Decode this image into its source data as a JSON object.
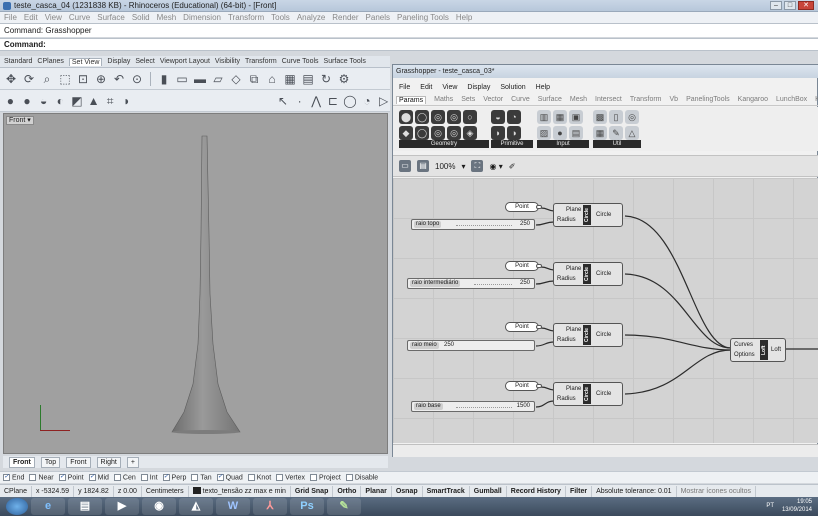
{
  "rhino": {
    "title": "teste_casca_04 (1231838 KB) - Rhinoceros (Educational) (64-bit) - [Front]",
    "menu": [
      "File",
      "Edit",
      "View",
      "Curve",
      "Surface",
      "Solid",
      "Mesh",
      "Dimension",
      "Transform",
      "Tools",
      "Analyze",
      "Render",
      "Panels",
      "Paneling Tools",
      "Help"
    ],
    "command_history": "Command: Grasshopper",
    "command_prompt": "Command:",
    "toolbar_tabs": [
      "Standard",
      "CPlanes",
      "Set View",
      "Display",
      "Select",
      "Viewport Layout",
      "Visibility",
      "Transform",
      "Curve Tools",
      "Surface Tools"
    ],
    "active_tab_index": 2,
    "viewport_label": "Front",
    "viewport_tabs": [
      "Front",
      "Top",
      "Front",
      "Right"
    ],
    "viewport_add": "+",
    "osnaps": [
      {
        "label": "End",
        "checked": true
      },
      {
        "label": "Near",
        "checked": false
      },
      {
        "label": "Point",
        "checked": true
      },
      {
        "label": "Mid",
        "checked": true
      },
      {
        "label": "Cen",
        "checked": false
      },
      {
        "label": "Int",
        "checked": false
      },
      {
        "label": "Perp",
        "checked": true
      },
      {
        "label": "Tan",
        "checked": false
      },
      {
        "label": "Quad",
        "checked": true
      },
      {
        "label": "Knot",
        "checked": false
      },
      {
        "label": "Vertex",
        "checked": false
      },
      {
        "label": "Project",
        "checked": false
      },
      {
        "label": "Disable",
        "checked": false
      }
    ],
    "status": {
      "cplane": "CPlane",
      "x": "x -5324.59",
      "y": "y 1824.82",
      "z": "z 0.00",
      "units": "Centimeters",
      "layer": "texto_tensão zz max e min",
      "toggles": [
        "Grid Snap",
        "Ortho",
        "Planar",
        "Osnap",
        "SmartTrack",
        "Gumball",
        "Record History",
        "Filter"
      ],
      "tolerance": "Absolute tolerance: 0.01",
      "hint": "Mostrar ícones ocultos"
    }
  },
  "grasshopper": {
    "title": "Grasshopper - teste_casca_03*",
    "menu": [
      "File",
      "Edit",
      "View",
      "Display",
      "Solution",
      "Help"
    ],
    "tabs": [
      "Params",
      "Maths",
      "Sets",
      "Vector",
      "Curve",
      "Surface",
      "Mesh",
      "Intersect",
      "Transform",
      "Vb",
      "PanelingTools",
      "Kangaroo",
      "LunchBox",
      "Ka"
    ],
    "active_tab_index": 0,
    "ribbon_groups": [
      "Geometry",
      "Primitive",
      "Input",
      "Util"
    ],
    "zoom": "100%",
    "components": {
      "point_label": "Point",
      "plane_label": "Plane",
      "radius_label": "Radius",
      "circle_label": "Circle",
      "curves_label": "Curves",
      "options_label": "Options",
      "loft_label": "Loft"
    },
    "sliders": [
      {
        "name": "raio topo",
        "value": "250"
      },
      {
        "name": "raio intermediário",
        "value": "250"
      },
      {
        "name": "raio meio",
        "value": "250"
      },
      {
        "name": "raio base",
        "value": "1500"
      }
    ]
  },
  "taskbar": {
    "lang": "PT",
    "time": "19:05",
    "date": "13/09/2014"
  },
  "colors": {
    "viewport_bg": "#a0a0a0",
    "object": "#8a8a8a",
    "gh_canvas": "#d3d3d3",
    "taskbar": "#3b4a5c"
  }
}
